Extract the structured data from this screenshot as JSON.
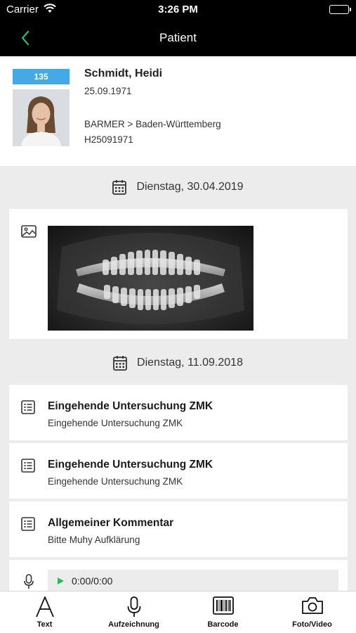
{
  "status_bar": {
    "carrier": "Carrier",
    "time": "3:26 PM"
  },
  "nav": {
    "title": "Patient",
    "accent_color": "#2fb463"
  },
  "patient": {
    "id_badge": "135",
    "badge_color": "#45a9e6",
    "name": "Schmidt, Heidi",
    "birth_date": "25.09.1971",
    "insurance": "BARMER > Baden-Württemberg",
    "insurance_number": "H25091971"
  },
  "timeline": {
    "date_1": "Dienstag, 30.04.2019",
    "date_2": "Dienstag, 11.09.2018",
    "entries": [
      {
        "title": "Eingehende Untersuchung ZMK",
        "subtitle": "Eingehende Untersuchung ZMK"
      },
      {
        "title": "Eingehende Untersuchung ZMK",
        "subtitle": "Eingehende Untersuchung ZMK"
      },
      {
        "title": "Allgemeiner Kommentar",
        "subtitle": "Bitte Muhy Aufklärung"
      }
    ],
    "audio": {
      "timecode": "0:00/0:00"
    }
  },
  "tab_bar": {
    "tabs": [
      {
        "label": "Text",
        "icon": "text-icon"
      },
      {
        "label": "Aufzeichnung",
        "icon": "microphone-icon"
      },
      {
        "label": "Barcode",
        "icon": "barcode-icon"
      },
      {
        "label": "Foto/Video",
        "icon": "camera-icon"
      }
    ]
  }
}
